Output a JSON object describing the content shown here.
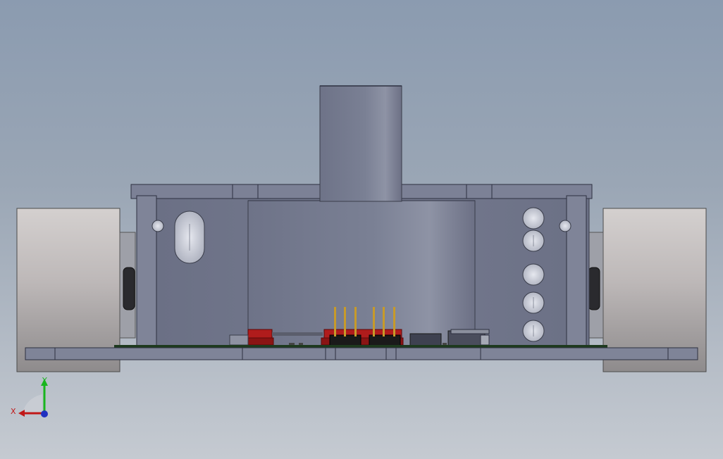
{
  "viewport": {
    "background_top": "#8b9bb0",
    "background_bottom": "#c5cad1"
  },
  "model": {
    "part_colors": {
      "frame": "#7a7f94",
      "cylinder": "#70758a",
      "wheel": "#b8b5b5",
      "pcb": "#1e3a1e",
      "red_connector": "#b01c1c",
      "pins": "#c79a2a",
      "black_header": "#1a1a1a"
    }
  },
  "triad": {
    "y_label": "Y",
    "x_label": "X",
    "y_color": "#19b51e",
    "x_color": "#c01818",
    "z_color": "#2030c0",
    "icon": "coordinate-triad-icon"
  }
}
